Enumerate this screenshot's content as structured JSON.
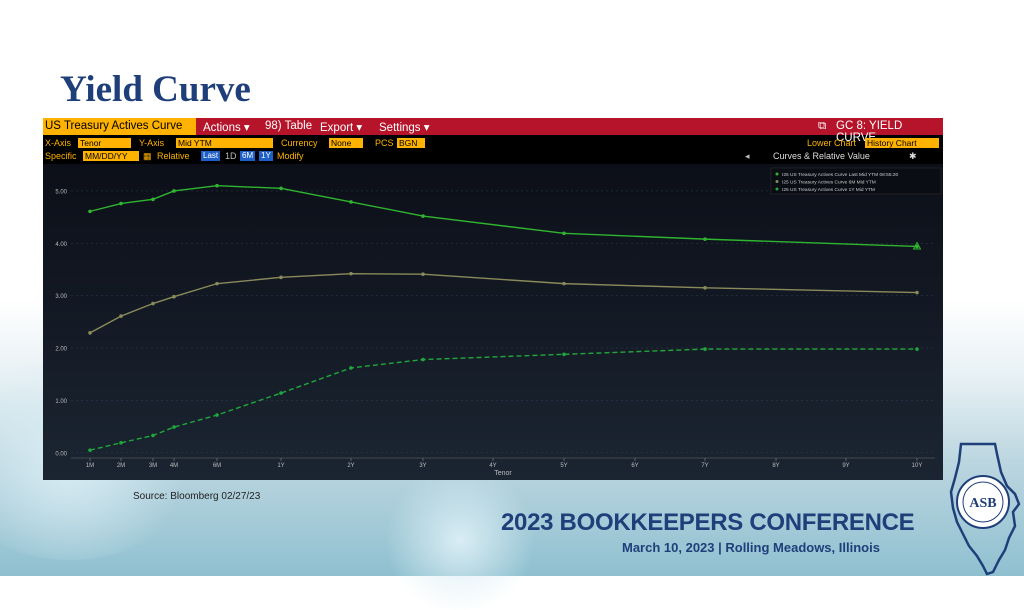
{
  "slide": {
    "title": "Yield Curve",
    "source": "Source: Bloomberg 02/27/23",
    "conference_title": "2023 BOOKKEEPERS CONFERENCE",
    "conference_subtitle": "March 10, 2023 | Rolling Meadows, Illinois"
  },
  "terminal": {
    "active_tab": "US Treasury Actives Curve",
    "menu": [
      "Actions ▾",
      "98) Table",
      "Export ▾",
      "Settings ▾"
    ],
    "page_code": "GC 8: YIELD CURVE",
    "xaxis_label": "X-Axis",
    "xaxis_value": "Tenor",
    "yaxis_label": "Y-Axis",
    "yaxis_value": "Mid YTM",
    "currency_label": "Currency",
    "currency_value": "None",
    "pcs_label": "PCS",
    "pcs_value": "BGN",
    "lower_chart_label": "Lower Chart",
    "lower_chart_value": "History Chart",
    "specific_label": "Specific",
    "date_placeholder": "MM/DD/YY",
    "relative_label": "Relative",
    "relative_buttons": [
      "Last",
      "1D",
      "6M",
      "1Y"
    ],
    "modify_label": "Modify",
    "curves_label": "Curves & Relative Value",
    "colors": {
      "bar": "#b5142a",
      "amber": "#ffb300",
      "series_last": "#2fb52f",
      "series_6m": "#8a8a5a",
      "series_1y": "#1fa83a"
    }
  },
  "chart_data": {
    "type": "line",
    "xlabel": "Tenor",
    "x": [
      "1M",
      "2M",
      "3M",
      "4M",
      "6M",
      "1Y",
      "2Y",
      "3Y",
      "4Y",
      "5Y",
      "6Y",
      "7Y",
      "8Y",
      "9Y",
      "10Y"
    ],
    "y_ticks": [
      "0.00",
      "1.00",
      "2.00",
      "3.00",
      "4.00",
      "5.00"
    ],
    "ylim": [
      -0.1,
      5.4
    ],
    "series": [
      {
        "name": "I25 US Treasury Actives Curve Last Mid YTM 08:55:20",
        "style": "solid",
        "color": "#2fb52f",
        "tenors": [
          "1M",
          "2M",
          "3M",
          "4M",
          "6M",
          "1Y",
          "2Y",
          "3Y",
          "5Y",
          "7Y",
          "10Y"
        ],
        "values": [
          4.61,
          4.76,
          4.84,
          5.0,
          5.1,
          5.05,
          4.79,
          4.52,
          4.19,
          4.08,
          3.94
        ]
      },
      {
        "name": "I25 US Treasury Actives Curve 6M Mid YTM",
        "style": "solid",
        "color": "#8a8a5a",
        "tenors": [
          "1M",
          "2M",
          "3M",
          "4M",
          "6M",
          "1Y",
          "2Y",
          "3Y",
          "5Y",
          "7Y",
          "10Y"
        ],
        "values": [
          2.29,
          2.61,
          2.85,
          2.98,
          3.23,
          3.35,
          3.42,
          3.41,
          3.23,
          3.15,
          3.06
        ]
      },
      {
        "name": "I25 US Treasury Actives Curve 1Y Mid YTM",
        "style": "dashed",
        "color": "#1fa83a",
        "tenors": [
          "1M",
          "2M",
          "3M",
          "4M",
          "6M",
          "1Y",
          "2Y",
          "3Y",
          "5Y",
          "7Y",
          "10Y"
        ],
        "values": [
          0.05,
          0.19,
          0.33,
          0.49,
          0.72,
          1.14,
          1.62,
          1.78,
          1.88,
          1.98,
          1.98
        ]
      }
    ]
  }
}
